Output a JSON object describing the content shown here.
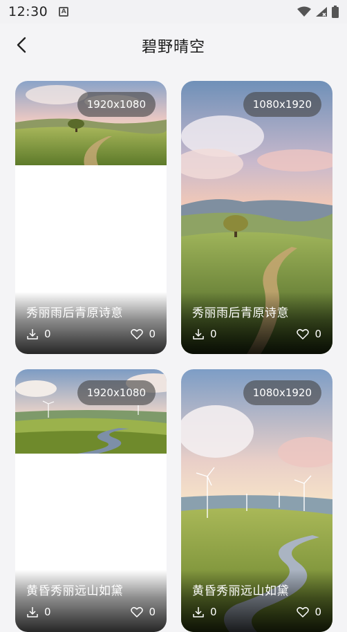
{
  "status": {
    "time": "12:30"
  },
  "header": {
    "title": "碧野晴空"
  },
  "cards": [
    {
      "resolution": "1920x1080",
      "caption": "秀丽雨后青原诗意",
      "downloads": "0",
      "likes": "0"
    },
    {
      "resolution": "1080x1920",
      "caption": "秀丽雨后青原诗意",
      "downloads": "0",
      "likes": "0"
    },
    {
      "resolution": "1920x1080",
      "caption": "黄昏秀丽远山如黛",
      "downloads": "0",
      "likes": "0"
    },
    {
      "resolution": "1080x1920",
      "caption": "黄昏秀丽远山如黛",
      "downloads": "0",
      "likes": "0"
    }
  ]
}
